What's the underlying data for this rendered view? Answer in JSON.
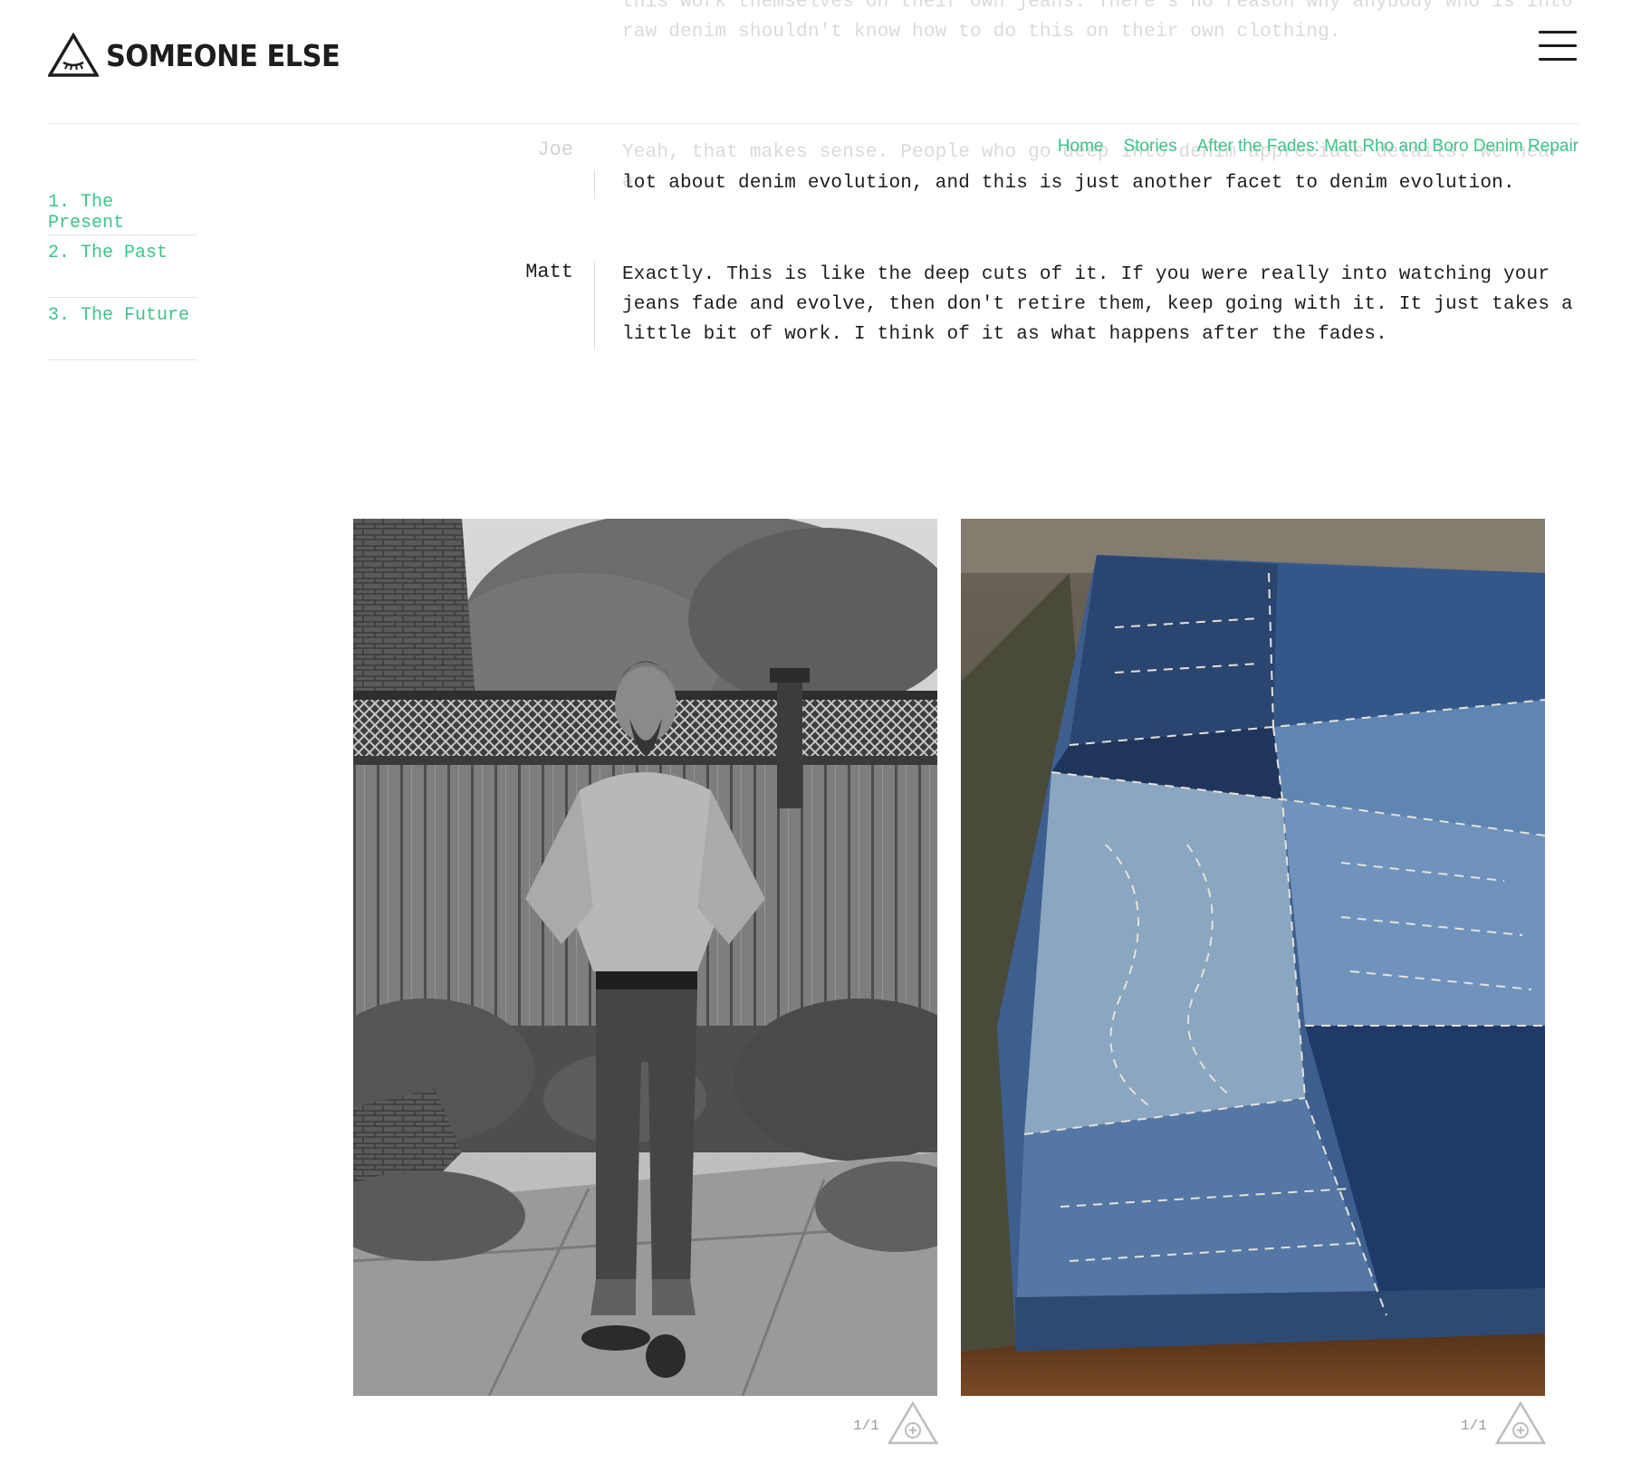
{
  "site": {
    "name": "SOMEONE ELSE"
  },
  "breadcrumb": [
    "Home",
    "Stories",
    "After the Fades: Matt Rho and Boro Denim Repair"
  ],
  "toc": [
    "1. The Present",
    "2. The Past",
    "3. The Future"
  ],
  "faded_text": {
    "line1": "this work themselves on their own jeans. There's no reason why anybody who is into",
    "line2": "raw denim shouldn't know how to do this on their own clothing.",
    "joe_line1": "Yeah, that makes sense. People who go deep into denim appreciate details. We hear a"
  },
  "dialogue": [
    {
      "speaker": "Joe",
      "text": "lot about denim evolution, and this is just another facet to denim evolution."
    },
    {
      "speaker": "Matt",
      "lines": [
        "Exactly. This is like the deep cuts of it. If you were really into watching your",
        "jeans fade and evolve, then don't retire them, keep going with it. It just takes a",
        "little bit of work. I think of it as what happens after the fades."
      ]
    }
  ],
  "gallery": [
    {
      "counter": "1/1",
      "icon": "zoom-eye-icon"
    },
    {
      "counter": "1/1",
      "icon": "zoom-eye-icon"
    }
  ],
  "colors": {
    "accent": "#3cc488",
    "text": "#1d1d1f",
    "muted": "#9a9a9a"
  }
}
